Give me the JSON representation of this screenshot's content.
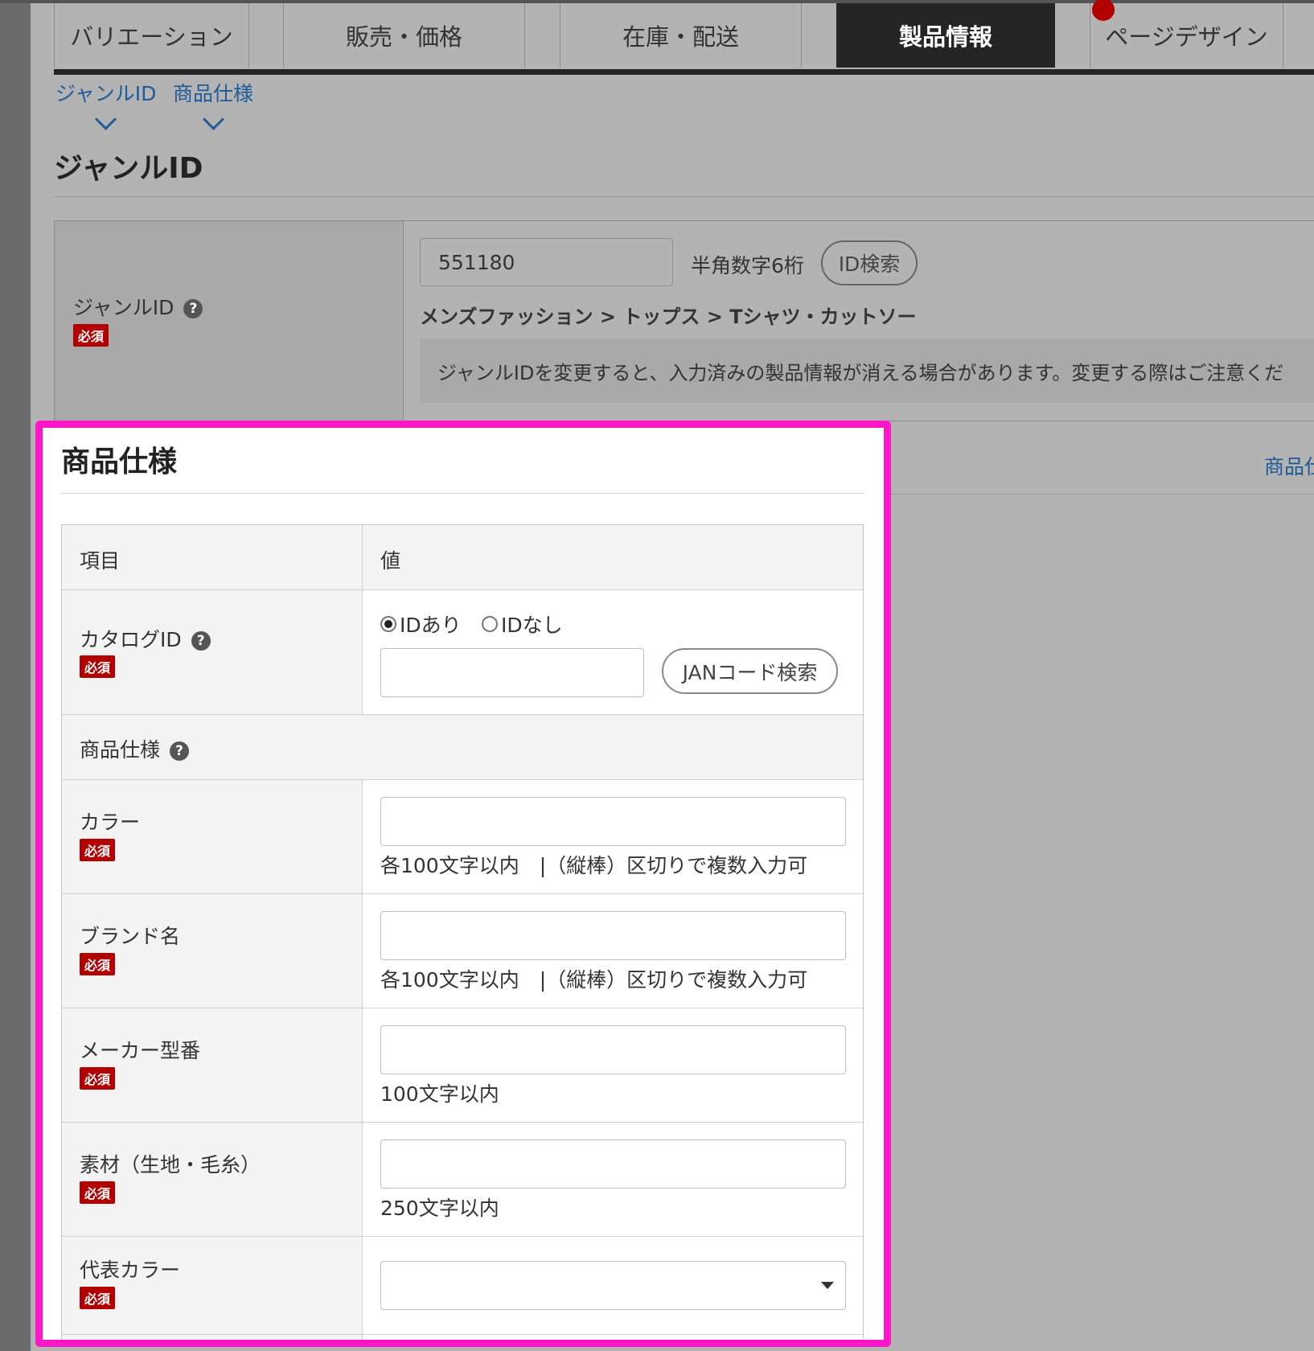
{
  "tabs": [
    {
      "label": "バリエーション",
      "active": false
    },
    {
      "label": "販売・価格",
      "active": false
    },
    {
      "label": "在庫・配送",
      "active": false
    },
    {
      "label": "製品情報",
      "active": true
    },
    {
      "label": "ページデザイン",
      "active": false
    }
  ],
  "anchors": [
    "ジャンルID",
    "商品仕様"
  ],
  "genre": {
    "title": "ジャンルID",
    "label": "ジャンルID",
    "required": "必須",
    "value": "551180",
    "hint": "半角数字6桁",
    "search_button": "ID検索",
    "path": "メンズファッション > トップス > Tシャツ・カットソー",
    "note": "ジャンルIDを変更すると、入力済みの製品情報が消える場合があります。変更する際はご注意くだ"
  },
  "right_link": "商品仕",
  "spec": {
    "title": "商品仕様",
    "header_item": "項目",
    "header_value": "値",
    "catalog": {
      "label": "カタログID",
      "required": "必須",
      "radio_yes": "IDあり",
      "radio_no": "IDなし",
      "selected": "yes",
      "search_button": "JANコード検索",
      "value": ""
    },
    "subsection_label": "商品仕様",
    "fields": [
      {
        "label": "カラー",
        "required": "必須",
        "hint": "各100文字以内　|（縦棒）区切りで複数入力可",
        "value": ""
      },
      {
        "label": "ブランド名",
        "required": "必須",
        "hint": "各100文字以内　|（縦棒）区切りで複数入力可",
        "value": ""
      },
      {
        "label": "メーカー型番",
        "required": "必須",
        "hint": "100文字以内",
        "value": ""
      },
      {
        "label": "素材（生地・毛糸）",
        "required": "必須",
        "hint": "250文字以内",
        "value": ""
      },
      {
        "label": "代表カラー",
        "required": "必須",
        "hint": "",
        "value": ""
      }
    ]
  }
}
